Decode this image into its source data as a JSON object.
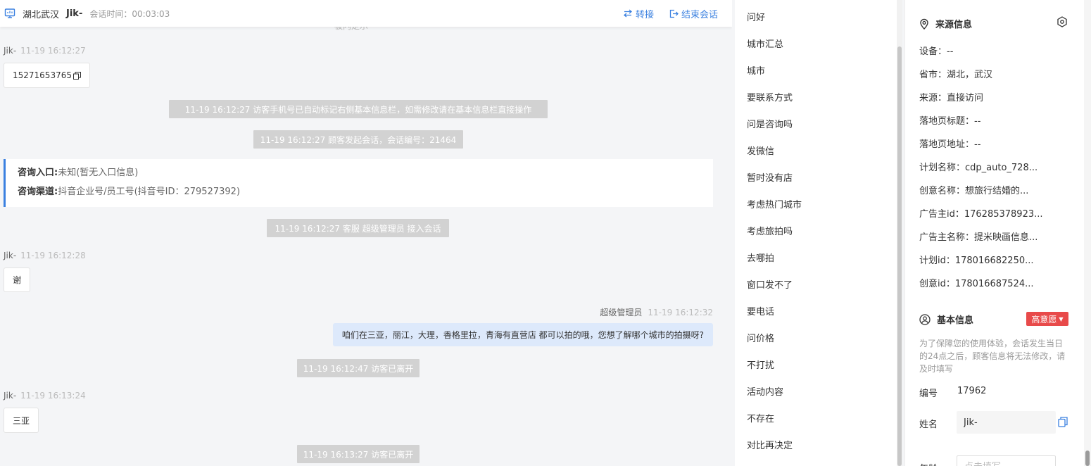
{
  "header": {
    "location": "湖北武汉",
    "visitor_name": "Jik-",
    "duration_label": "会话时间：",
    "duration": "00:03:03",
    "transfer_label": "转接",
    "end_label": "结束会话",
    "partial_text": "被内定示"
  },
  "chat": {
    "messages": [
      {
        "sender": "Jik-",
        "time": "11-19 16:12:27",
        "text": "15271653765"
      },
      {
        "system": "11-19 16:12:27 访客手机号已自动标记右侧基本信息栏，如需修改请在基本信息栏直接操作"
      },
      {
        "system": "11-19 16:12:27 顾客发起会话，会话编号：21464"
      },
      {
        "entry_key": "咨询入口:",
        "entry_value": "未知(暂无入口信息)",
        "channel_key": "咨询渠道:",
        "channel_value": "抖音企业号/员工号(抖音号ID：279527392)"
      },
      {
        "system": "11-19 16:12:27 客服 超级管理员 接入会话"
      },
      {
        "sender": "Jik-",
        "time": "11-19 16:12:28",
        "text": "谢"
      },
      {
        "sender": "超级管理员",
        "time": "11-19 16:12:32",
        "text": "咱们在三亚，丽江，大理，香格里拉，青海有直营店 都可以拍的哦，您想了解哪个城市的拍摄呀?"
      },
      {
        "system": "11-19 16:12:47 访客已离开"
      },
      {
        "sender": "Jik-",
        "time": "11-19 16:13:24",
        "text": "三亚"
      },
      {
        "system": "11-19 16:13:27 访客已离开"
      }
    ]
  },
  "quick_replies": [
    "问好",
    "城市汇总",
    "城市",
    "要联系方式",
    "问是咨询吗",
    "发微信",
    "暂时没有店",
    "考虑热门城市",
    "考虑旅拍吗",
    "去哪拍",
    "窗口发不了",
    "要电话",
    "问价格",
    "不打扰",
    "活动内容",
    "不存在",
    "对比再决定"
  ],
  "source_info": {
    "title": "来源信息",
    "rows": [
      "设备：--",
      "省市：湖北，武汉",
      "来源：直接访问",
      "落地页标题：--",
      "落地页地址：--",
      "计划名称：cdp_auto_728...",
      "创意名称：想旅行结婚的...",
      "广告主id：176285378923...",
      "广告主名称：提米映画信息...",
      "计划id：178016682250...",
      "创意id：178016687524..."
    ]
  },
  "basic_info": {
    "title": "基本信息",
    "intent": "高意愿",
    "notice": "为了保障您的使用体验，会话发生当日的24点之后，顾客信息将无法修改，请及时填写",
    "id_label": "编号",
    "id_value": "17962",
    "name_label": "姓名",
    "name_value": "Jik-",
    "age_label": "年龄",
    "age_placeholder": "点击填写"
  },
  "colors": {
    "accent": "#3a80e0",
    "intent_red": "#e84a4a",
    "agent_bubble": "#dde9fb",
    "system_gray": "#d2d2d2"
  }
}
